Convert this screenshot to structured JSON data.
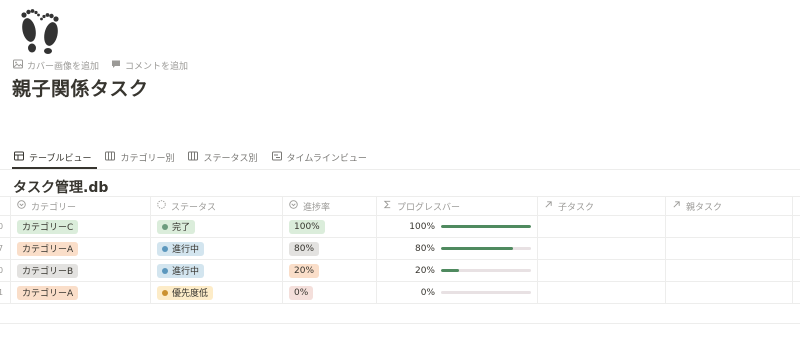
{
  "page": {
    "icon": "footprints-icon",
    "actions": [
      {
        "icon": "image-icon",
        "label": "カバー画像を追加"
      },
      {
        "icon": "comment-icon",
        "label": "コメントを追加"
      }
    ],
    "title": "親子関係タスク"
  },
  "views": [
    {
      "icon": "table-icon",
      "label": "テーブルビュー",
      "active": true
    },
    {
      "icon": "board-icon",
      "label": "カテゴリー別",
      "active": false
    },
    {
      "icon": "board-icon",
      "label": "ステータス別",
      "active": false
    },
    {
      "icon": "timeline-icon",
      "label": "タイムラインビュー",
      "active": false
    }
  ],
  "database": {
    "title": "タスク管理.db",
    "columns": [
      {
        "icon": "select-icon",
        "label": "カテゴリー"
      },
      {
        "icon": "status-icon",
        "label": "ステータス"
      },
      {
        "icon": "select-icon",
        "label": "進捗率"
      },
      {
        "icon": "formula-icon",
        "label": "プログレスバー"
      },
      {
        "icon": "relation-icon",
        "label": "子タスク"
      },
      {
        "icon": "relation-icon",
        "label": "親タスク"
      }
    ],
    "rows": [
      {
        "edge": "0",
        "category": "カテゴリーC",
        "status": "完了",
        "rate": "100%",
        "progress_label": "100%",
        "progress": 1.0
      },
      {
        "edge": "7",
        "category": "カテゴリーA",
        "status": "進行中",
        "rate": "80%",
        "progress_label": "80%",
        "progress": 0.8
      },
      {
        "edge": "0",
        "category": "カテゴリーB",
        "status": "進行中",
        "rate": "20%",
        "progress_label": "20%",
        "progress": 0.2
      },
      {
        "edge": "1",
        "category": "カテゴリーA",
        "status": "優先度低",
        "rate": "0%",
        "progress_label": "0%",
        "progress": 0.0
      }
    ]
  },
  "colors": {
    "cat_c_bg": "#dbeddb",
    "cat_a_bg": "#fadec9",
    "cat_b_bg": "#e3e2e0",
    "status_done_bg": "#dbeddb",
    "status_done_dot": "#6c9b7d",
    "status_progress_bg": "#d3e5ef",
    "status_progress_dot": "#5b97bd",
    "status_low_bg": "#fdecc8",
    "status_low_dot": "#cb912f",
    "rate_100_bg": "#dbeddb",
    "rate_80_bg": "#e3e2e0",
    "rate_20_bg": "#fadec9",
    "rate_0_bg": "#f4dfdb",
    "progress_fill": "#4f8a5f"
  }
}
